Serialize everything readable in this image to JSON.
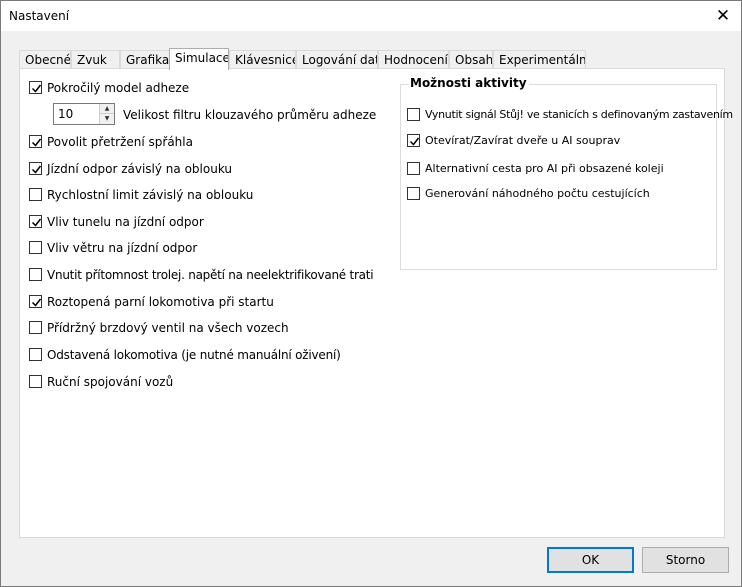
{
  "window": {
    "title": "Nastavení"
  },
  "tabs": [
    "Obecné",
    "Zvuk",
    "Grafika",
    "Simulace",
    "Klávesnice",
    "Logování dat",
    "Hodnocení",
    "Obsah",
    "Experimentální"
  ],
  "active_tab": "Simulace",
  "left_options": [
    {
      "label": "Pokročilý model adheze",
      "checked": true
    },
    {
      "label": "Povolit přetržení spřáhla",
      "checked": true
    },
    {
      "label": "Jízdní odpor závislý na oblouku",
      "checked": true
    },
    {
      "label": "Rychlostní limit závislý na oblouku",
      "checked": false
    },
    {
      "label": "Vliv tunelu na jízdní odpor",
      "checked": true
    },
    {
      "label": "Vliv větru na jízdní odpor",
      "checked": false
    },
    {
      "label": "Vnutit přítomnost trolej. napětí na neelektrifikované trati",
      "checked": false
    },
    {
      "label": "Roztopená parní lokomotiva při startu",
      "checked": true
    },
    {
      "label": "Přídržný brzdový ventil na všech vozech",
      "checked": false
    },
    {
      "label": "Odstavená lokomotiva (je nutné manuální oživení)",
      "checked": false
    },
    {
      "label": "Ruční spojování vozů",
      "checked": false
    }
  ],
  "adhesion_filter": {
    "value": "10",
    "label": "Velikost filtru klouzavého průměru adheze"
  },
  "activity_group": {
    "title": "Možnosti aktivity",
    "options": [
      {
        "label": "Vynutit signál Stůj! ve stanicích s definovaným zastavením",
        "checked": false
      },
      {
        "label": "Otevírat/Zavírat dveře u AI souprav",
        "checked": true
      },
      {
        "label": "Alternativní cesta pro AI při obsazené koleji",
        "checked": false
      },
      {
        "label": "Generování náhodného počtu cestujících",
        "checked": false
      }
    ]
  },
  "buttons": {
    "ok": "OK",
    "cancel": "Storno"
  }
}
